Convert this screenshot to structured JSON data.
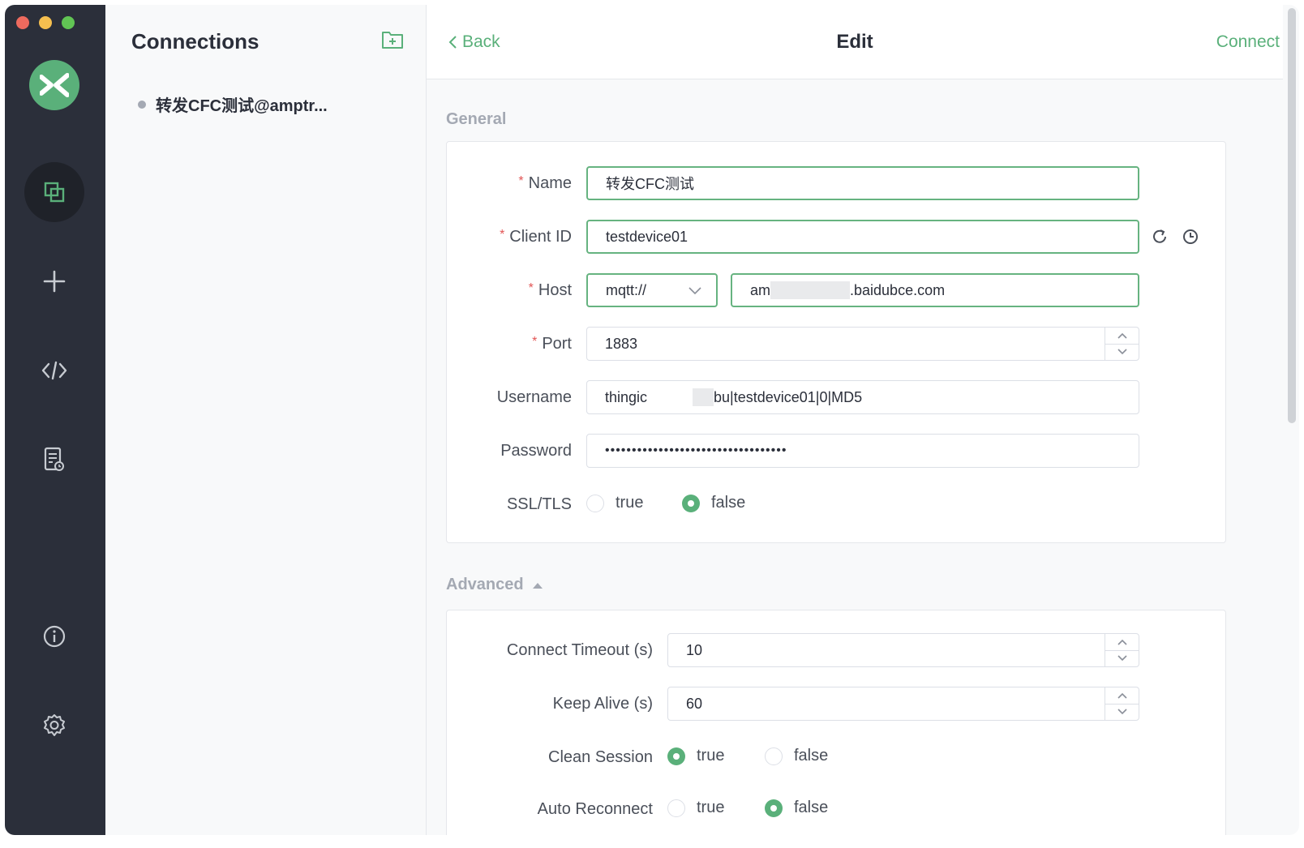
{
  "nav": {
    "items": [
      {
        "name": "connections-icon",
        "active": true
      },
      {
        "name": "plus-icon"
      },
      {
        "name": "code-icon"
      },
      {
        "name": "log-icon"
      },
      {
        "name": "info-icon"
      },
      {
        "name": "gear-icon"
      }
    ]
  },
  "list": {
    "title": "Connections",
    "items": [
      {
        "label": "转发CFC测试@amptr..."
      }
    ]
  },
  "header": {
    "back_label": "Back",
    "title": "Edit",
    "connect_label": "Connect"
  },
  "general": {
    "section_title": "General",
    "name_label": "Name",
    "name_value": "转发CFC测试",
    "client_id_label": "Client ID",
    "client_id_value": "testdevice01",
    "host_label": "Host",
    "host_protocol": "mqtt://",
    "host_value_prefix": "am",
    "host_value_suffix": ".baidubce.com",
    "port_label": "Port",
    "port_value": "1883",
    "username_label": "Username",
    "username_value_prefix": "thingic",
    "username_value_suffix": "bu|testdevice01|0|MD5",
    "password_label": "Password",
    "password_value": "••••••••••••••••••••••••••••••••••",
    "ssl_label": "SSL/TLS",
    "ssl_true": "true",
    "ssl_false": "false",
    "ssl_selected": "false"
  },
  "advanced": {
    "section_title": "Advanced",
    "timeout_label": "Connect Timeout (s)",
    "timeout_value": "10",
    "keepalive_label": "Keep Alive (s)",
    "keepalive_value": "60",
    "clean_label": "Clean Session",
    "clean_true": "true",
    "clean_false": "false",
    "clean_selected": "true",
    "reconnect_label": "Auto Reconnect",
    "reconnect_true": "true",
    "reconnect_false": "false",
    "reconnect_selected": "false"
  },
  "colors": {
    "accent": "#5ab07a",
    "nav_bg": "#2b2f3a",
    "required": "#e25555"
  }
}
